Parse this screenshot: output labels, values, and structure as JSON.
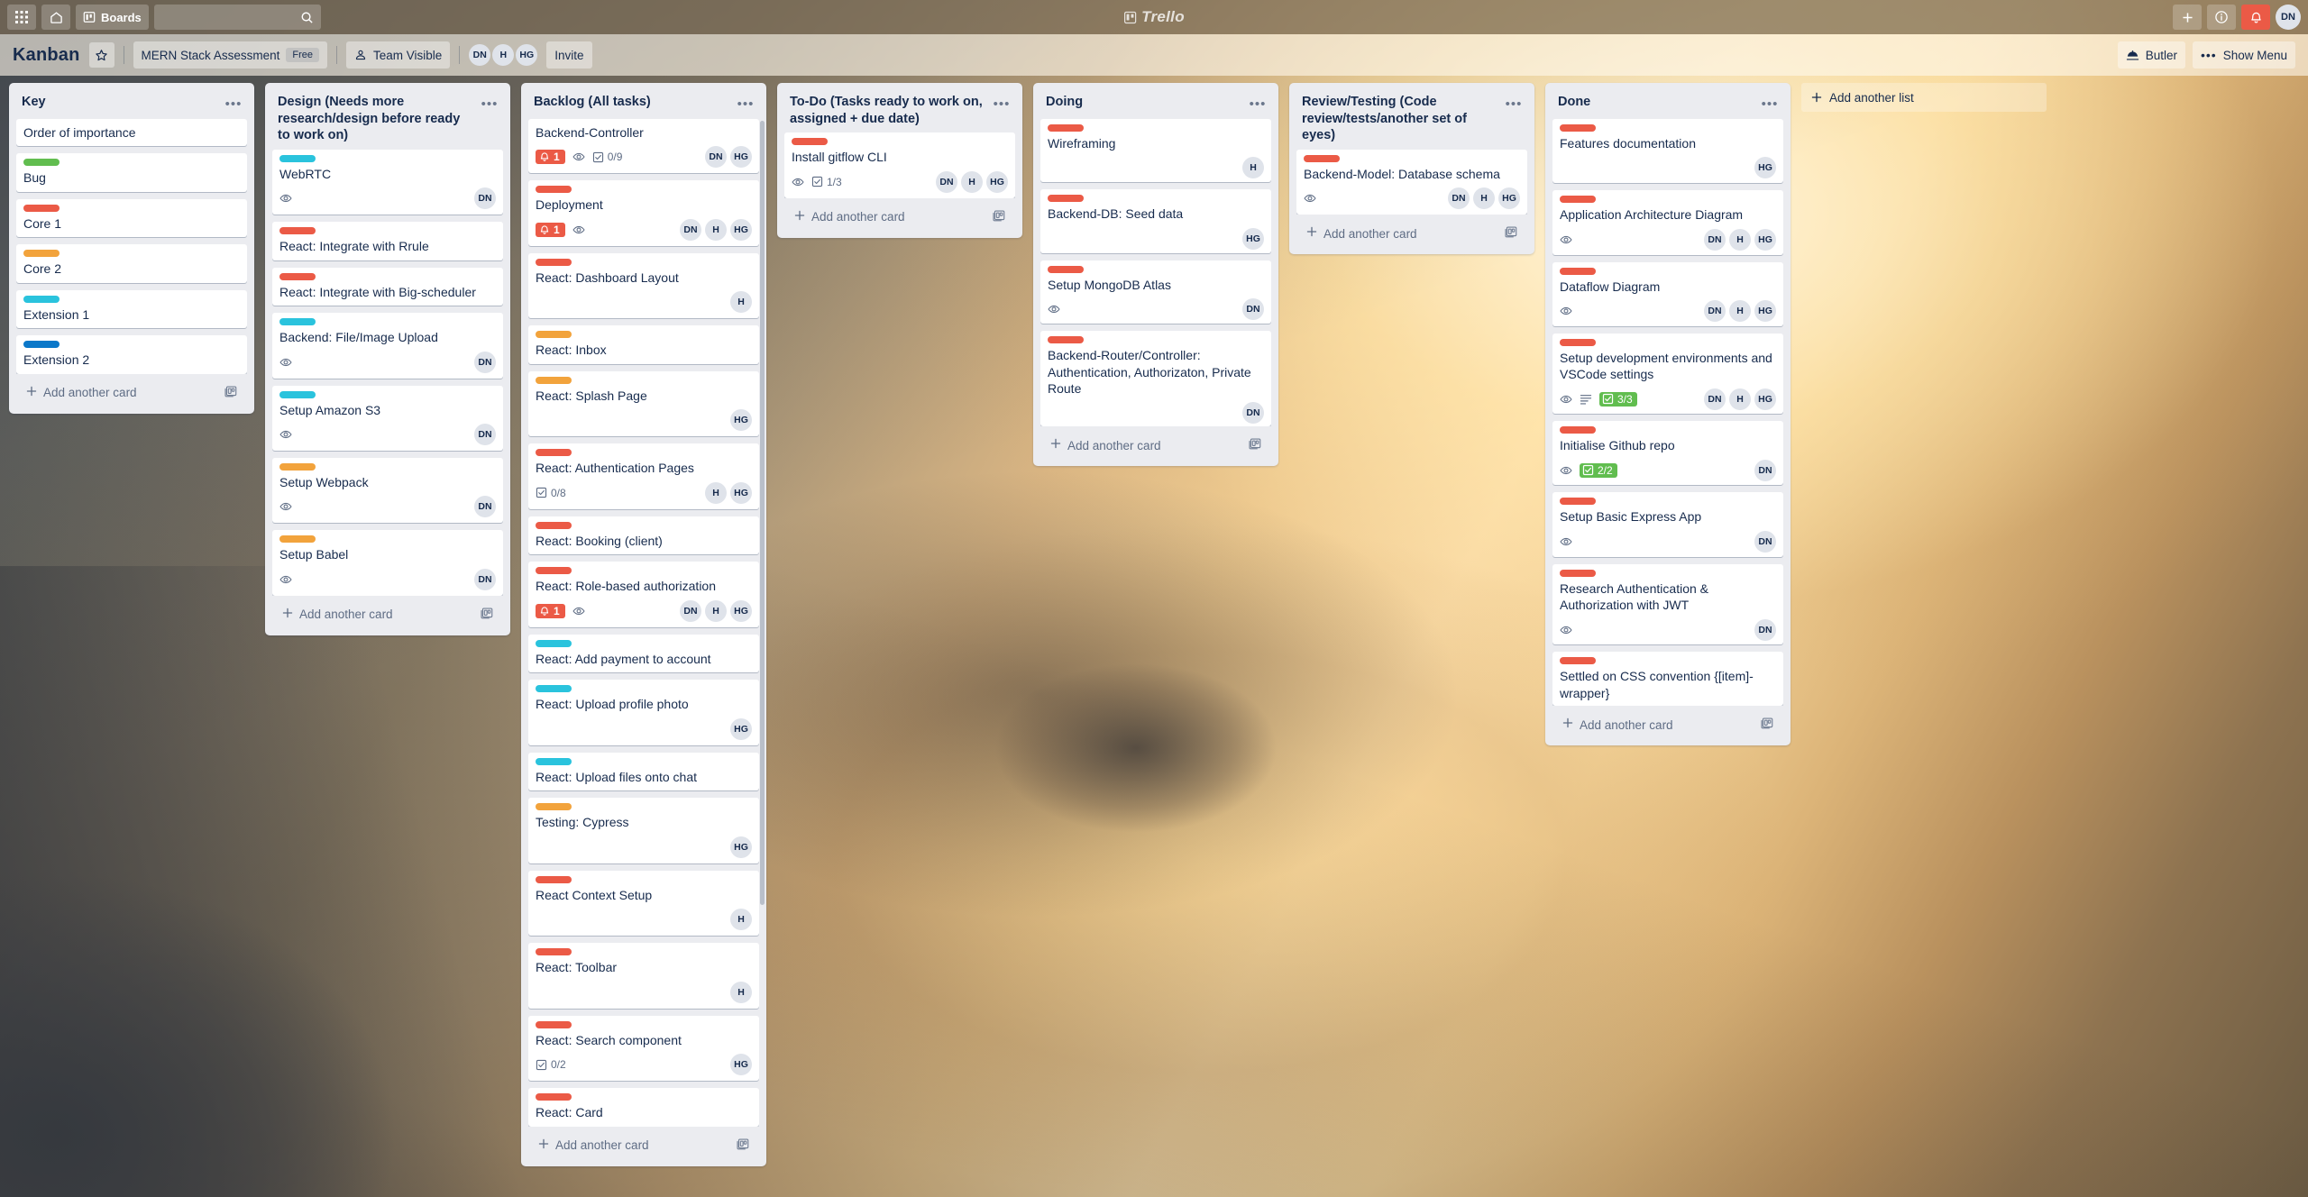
{
  "topnav": {
    "apps_icon": "grid-apps-icon",
    "home_icon": "home-icon",
    "boards_label": "Boards",
    "boards_icon": "board-icon",
    "search": {
      "placeholder": "",
      "value": "",
      "icon": "search-icon"
    },
    "brand": "Trello",
    "brand_icon": "trello-logo-icon",
    "add_icon": "plus-icon",
    "info_icon": "info-circle-icon",
    "notifications_icon": "bell-icon",
    "avatar": "DN"
  },
  "boardbar": {
    "title": "Kanban",
    "star_icon": "star-icon",
    "workspace": "MERN Stack Assessment",
    "plan_badge": "Free",
    "visibility": "Team Visible",
    "visibility_icon": "team-icon",
    "members": [
      "DN",
      "H",
      "HG"
    ],
    "invite_label": "Invite",
    "butler_label": "Butler",
    "butler_icon": "butler-icon",
    "menu_label": "Show Menu",
    "menu_icon": "dots-icon"
  },
  "add_list": {
    "label": "Add another list",
    "icon": "plus-icon"
  },
  "add_card": {
    "label": "Add another card",
    "icon": "plus-icon",
    "template_icon": "template-card-icon"
  },
  "label_colors": {
    "green": "#61bd4f",
    "red": "#eb5a46",
    "orange": "#f2a33c",
    "sky": "#2ac3dd",
    "blue": "#0b78c9"
  },
  "lists": [
    {
      "title": "Key",
      "cards": [
        {
          "title": "Order of importance",
          "labels": []
        },
        {
          "title": "Bug",
          "labels": [
            "green"
          ]
        },
        {
          "title": "Core 1",
          "labels": [
            "red"
          ]
        },
        {
          "title": "Core 2",
          "labels": [
            "orange"
          ]
        },
        {
          "title": "Extension 1",
          "labels": [
            "sky"
          ]
        },
        {
          "title": "Extension 2",
          "labels": [
            "blue"
          ]
        }
      ]
    },
    {
      "title": "Design (Needs more research/design before ready to work on)",
      "cards": [
        {
          "title": "WebRTC",
          "labels": [
            "sky"
          ],
          "watch": true,
          "members": [
            "DN"
          ]
        },
        {
          "title": "React: Integrate with Rrule",
          "labels": [
            "red"
          ]
        },
        {
          "title": "React: Integrate with Big-scheduler",
          "labels": [
            "red"
          ]
        },
        {
          "title": "Backend: File/Image Upload",
          "labels": [
            "sky"
          ],
          "watch": true,
          "members": [
            "DN"
          ]
        },
        {
          "title": "Setup Amazon S3",
          "labels": [
            "sky"
          ],
          "watch": true,
          "members": [
            "DN"
          ]
        },
        {
          "title": "Setup Webpack",
          "labels": [
            "orange"
          ],
          "watch": true,
          "members": [
            "DN"
          ]
        },
        {
          "title": "Setup Babel",
          "labels": [
            "orange"
          ],
          "watch": true,
          "members": [
            "DN"
          ]
        }
      ]
    },
    {
      "title": "Backlog (All tasks)",
      "scrolled": true,
      "cards": [
        {
          "title": "Backend-Controller",
          "labels": [],
          "due": "1",
          "watch": true,
          "checklist": "0/9",
          "members": [
            "DN",
            "HG"
          ]
        },
        {
          "title": "Deployment",
          "labels": [
            "red"
          ],
          "due": "1",
          "watch": true,
          "members": [
            "DN",
            "H",
            "HG"
          ]
        },
        {
          "title": "React: Dashboard Layout",
          "labels": [
            "red"
          ],
          "members": [
            "H"
          ]
        },
        {
          "title": "React: Inbox",
          "labels": [
            "orange"
          ]
        },
        {
          "title": "React: Splash Page",
          "labels": [
            "orange"
          ],
          "members": [
            "HG"
          ]
        },
        {
          "title": "React: Authentication Pages",
          "labels": [
            "red"
          ],
          "checklist": "0/8",
          "members": [
            "H",
            "HG"
          ]
        },
        {
          "title": "React: Booking (client)",
          "labels": [
            "red"
          ]
        },
        {
          "title": "React: Role-based authorization",
          "labels": [
            "red"
          ],
          "due": "1",
          "watch": true,
          "members": [
            "DN",
            "H",
            "HG"
          ]
        },
        {
          "title": "React: Add payment to account",
          "labels": [
            "sky"
          ]
        },
        {
          "title": "React: Upload profile photo",
          "labels": [
            "sky"
          ],
          "members": [
            "HG"
          ]
        },
        {
          "title": "React: Upload files onto chat",
          "labels": [
            "sky"
          ]
        },
        {
          "title": "Testing: Cypress",
          "labels": [
            "orange"
          ],
          "members": [
            "HG"
          ]
        },
        {
          "title": "React Context Setup",
          "labels": [
            "red"
          ],
          "members": [
            "H"
          ]
        },
        {
          "title": "React: Toolbar",
          "labels": [
            "red"
          ],
          "members": [
            "H"
          ]
        },
        {
          "title": "React: Search component",
          "labels": [
            "red"
          ],
          "checklist": "0/2",
          "members": [
            "HG"
          ]
        },
        {
          "title": "React: Card",
          "labels": [
            "red"
          ]
        }
      ]
    },
    {
      "title": "To-Do (Tasks ready to work on, assigned + due date)",
      "cards": [
        {
          "title": "Install gitflow CLI",
          "labels": [
            "red"
          ],
          "watch": true,
          "checklist": "1/3",
          "members": [
            "DN",
            "H",
            "HG"
          ]
        }
      ]
    },
    {
      "title": "Doing",
      "cards": [
        {
          "title": "Wireframing",
          "labels": [
            "red"
          ],
          "members": [
            "H"
          ]
        },
        {
          "title": "Backend-DB: Seed data",
          "labels": [
            "red"
          ],
          "members": [
            "HG"
          ]
        },
        {
          "title": "Setup MongoDB Atlas",
          "labels": [
            "red"
          ],
          "watch": true,
          "members": [
            "DN"
          ]
        },
        {
          "title": "Backend-Router/Controller: Authentication, Authorizaton, Private Route",
          "labels": [
            "red"
          ],
          "members": [
            "DN"
          ]
        }
      ]
    },
    {
      "title": "Review/Testing (Code review/tests/another set of eyes)",
      "cards": [
        {
          "title": "Backend-Model: Database schema",
          "labels": [
            "red"
          ],
          "watch": true,
          "members": [
            "DN",
            "H",
            "HG"
          ]
        }
      ]
    },
    {
      "title": "Done",
      "cards": [
        {
          "title": "Features documentation",
          "labels": [
            "red"
          ],
          "members": [
            "HG"
          ]
        },
        {
          "title": "Application Architecture Diagram",
          "labels": [
            "red"
          ],
          "watch": true,
          "members": [
            "DN",
            "H",
            "HG"
          ]
        },
        {
          "title": "Dataflow Diagram",
          "labels": [
            "red"
          ],
          "watch": true,
          "members": [
            "DN",
            "H",
            "HG"
          ]
        },
        {
          "title": "Setup development environments and VSCode settings",
          "labels": [
            "red"
          ],
          "watch": true,
          "description": true,
          "checklist_done": "3/3",
          "members": [
            "DN",
            "H",
            "HG"
          ]
        },
        {
          "title": "Initialise Github repo",
          "labels": [
            "red"
          ],
          "watch": true,
          "checklist_done": "2/2",
          "members": [
            "DN"
          ]
        },
        {
          "title": "Setup Basic Express App",
          "labels": [
            "red"
          ],
          "watch": true,
          "members": [
            "DN"
          ]
        },
        {
          "title": "Research Authentication & Authorization with JWT",
          "labels": [
            "red"
          ],
          "watch": true,
          "members": [
            "DN"
          ]
        },
        {
          "title": "Settled on CSS convention {[item]-wrapper}",
          "labels": [
            "red"
          ]
        }
      ]
    }
  ]
}
